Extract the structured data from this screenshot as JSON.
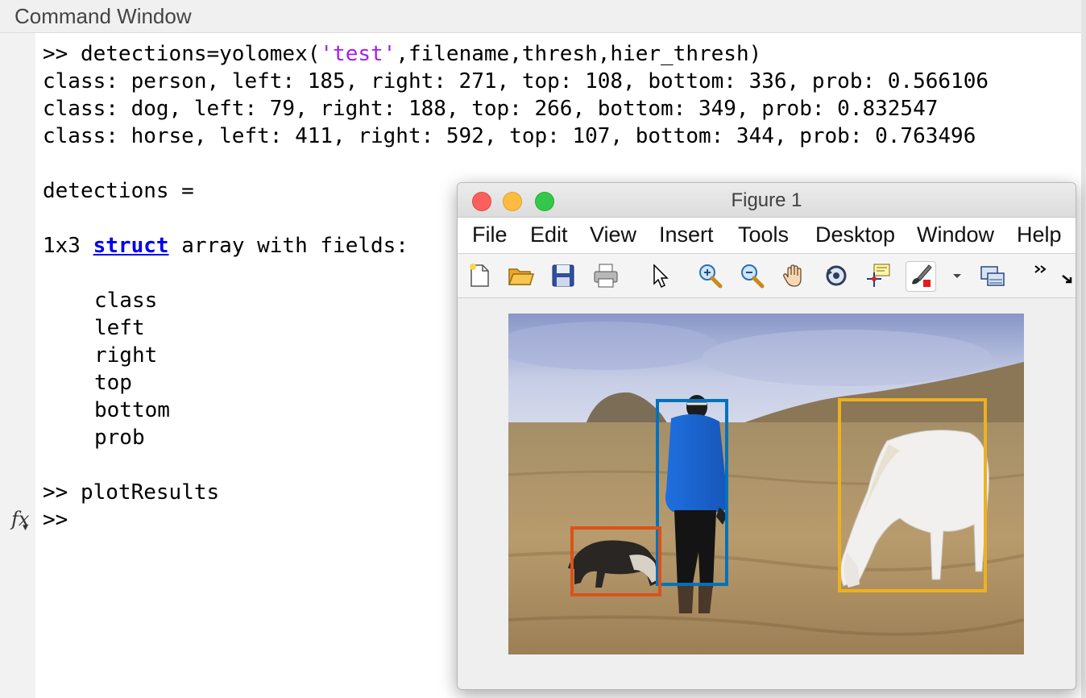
{
  "command_window": {
    "title": "Command Window",
    "prompt": ">>",
    "cmd1": "detections=yolomex(",
    "cmd1_str": "'test'",
    "cmd1_rest": ",filename,thresh,hier_thresh)",
    "out1": "class: person, left: 185, right: 271, top: 108, bottom: 336, prob: 0.566106",
    "out2": "class: dog, left: 79, right: 188, top: 266, bottom: 349, prob: 0.832547",
    "out3": "class: horse, left: 411, right: 592, top: 107, bottom: 344, prob: 0.763496",
    "var_display": "detections =",
    "struct_prefix": "1x3 ",
    "struct_link": "struct",
    "struct_suffix": " array with fields:",
    "fields": [
      "class",
      "left",
      "right",
      "top",
      "bottom",
      "prob"
    ],
    "cmd2": "plotResults",
    "fx_icon": "fx-icon"
  },
  "figure": {
    "title": "Figure 1",
    "menu": [
      "File",
      "Edit",
      "View",
      "Insert",
      "Tools",
      "Desktop",
      "Window",
      "Help"
    ],
    "toolbar_icons": [
      "new-figure-icon",
      "open-file-icon",
      "save-icon",
      "print-icon",
      "pointer-icon",
      "zoom-in-icon",
      "zoom-out-icon",
      "pan-hand-icon",
      "rotate-3d-icon",
      "data-cursor-icon",
      "brush-icon",
      "brush-dropdown-icon",
      "link-plot-icon",
      "toolbar-overflow-icon",
      "dock-arrow-icon"
    ],
    "boxes": [
      {
        "label": "person",
        "color": "#0072bd"
      },
      {
        "label": "dog",
        "color": "#d95319"
      },
      {
        "label": "horse",
        "color": "#edb120"
      }
    ]
  }
}
